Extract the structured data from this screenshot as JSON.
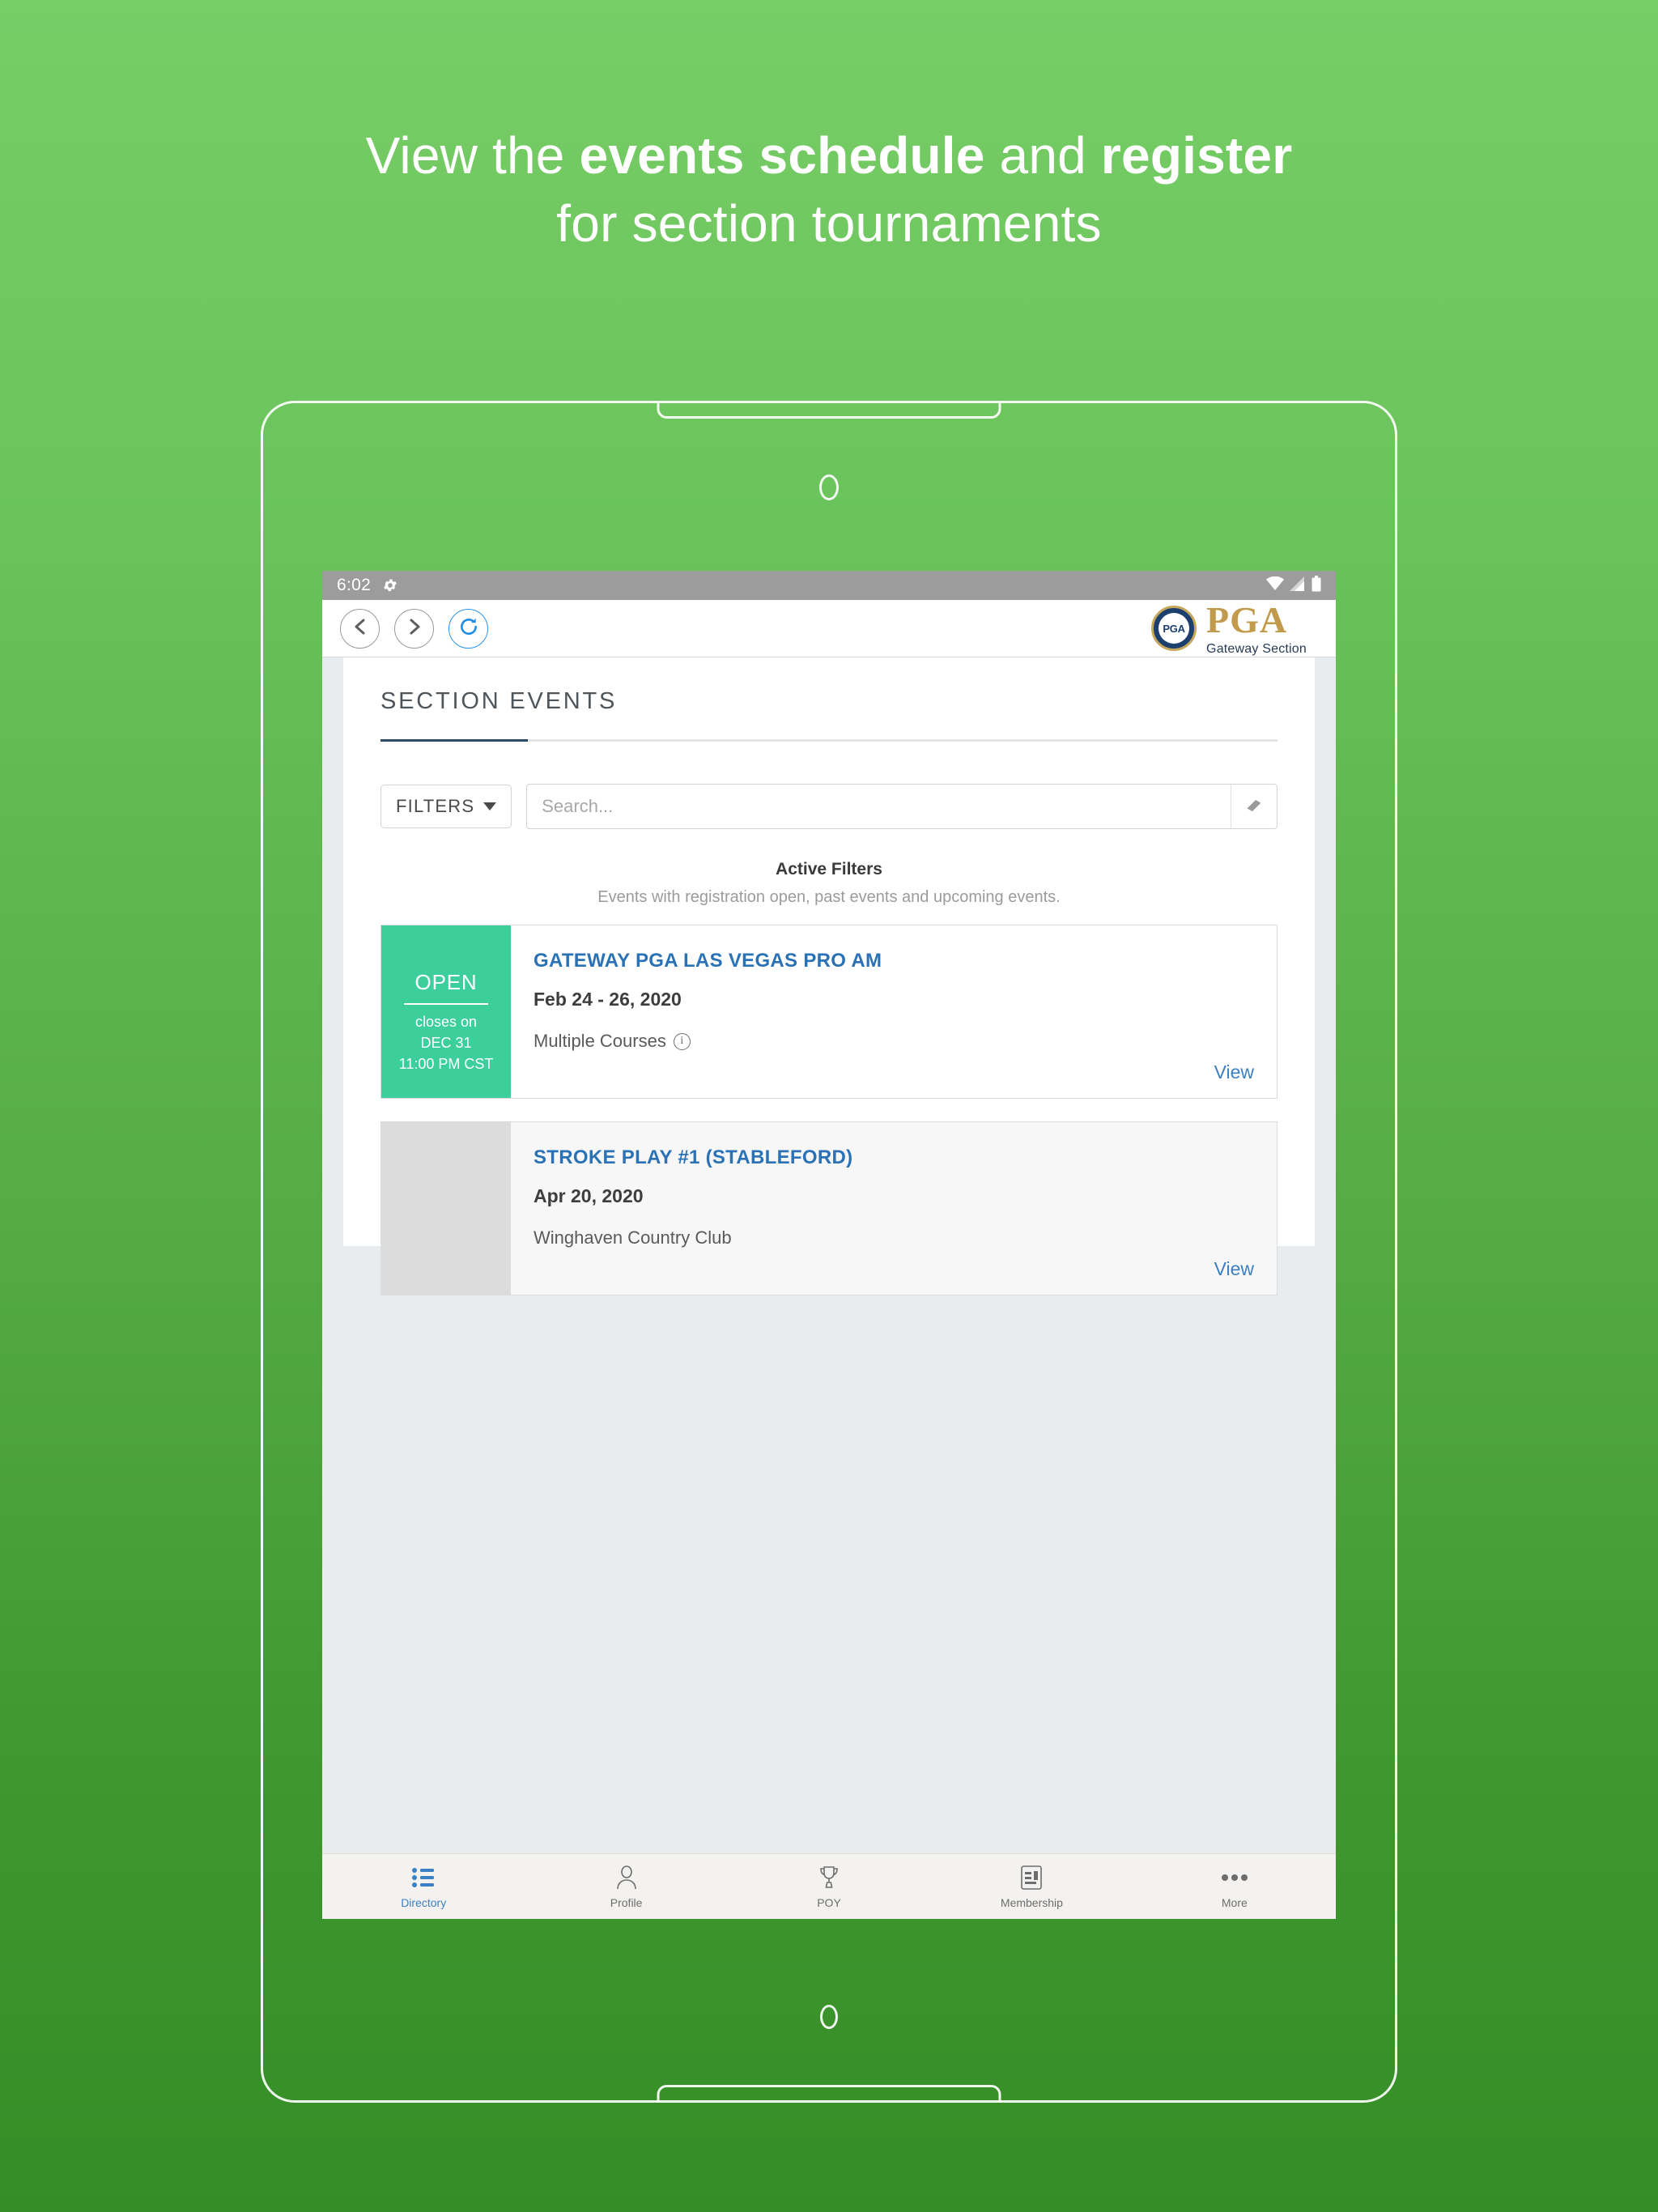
{
  "marketing": {
    "line1_prefix": "View the ",
    "line1_strong1": "events schedule",
    "line1_mid": " and ",
    "line1_strong2": "register",
    "line2": "for section tournaments"
  },
  "status_bar": {
    "time": "6:02",
    "gear_icon": "gear-icon",
    "wifi_icon": "wifi-icon",
    "signal_icon": "cell-signal-icon",
    "battery_icon": "battery-icon"
  },
  "browser": {
    "back_icon": "chevron-left-icon",
    "forward_icon": "chevron-right-icon",
    "refresh_icon": "refresh-icon",
    "brand": {
      "seal_text": "PGA",
      "wordmark": "PGA",
      "subtitle": "Gateway Section"
    }
  },
  "page": {
    "title": "SECTION EVENTS",
    "filters_button": "FILTERS",
    "search_placeholder": "Search...",
    "search_value": "",
    "eraser_icon": "eraser-icon",
    "active_filters_title": "Active Filters",
    "active_filters_desc": "Events with registration open, past events and upcoming events."
  },
  "events": [
    {
      "status": "OPEN",
      "closes_label": "closes on",
      "closes_date": "DEC  31",
      "closes_time": "11:00 PM CST",
      "title": "GATEWAY PGA LAS VEGAS PRO AM",
      "date": "Feb 24 - 26, 2020",
      "venue": "Multiple Courses",
      "has_info_icon": true,
      "view_label": "View",
      "badge_color": "#3ccf9c"
    },
    {
      "status": "",
      "closes_label": "",
      "closes_date": "",
      "closes_time": "",
      "title": "STROKE PLAY #1 (STABLEFORD)",
      "date": "Apr 20, 2020",
      "venue": "Winghaven Country Club",
      "has_info_icon": false,
      "view_label": "View",
      "badge_color": "#dcdcdc"
    }
  ],
  "bottom_nav": [
    {
      "label": "Directory",
      "icon": "list-icon",
      "active": true
    },
    {
      "label": "Profile",
      "icon": "person-icon",
      "active": false
    },
    {
      "label": "POY",
      "icon": "trophy-icon",
      "active": false
    },
    {
      "label": "Membership",
      "icon": "id-card-icon",
      "active": false
    },
    {
      "label": "More",
      "icon": "ellipsis-icon",
      "active": false
    }
  ],
  "colors": {
    "background_top": "#77cd66",
    "background_bottom": "#358d27",
    "accent_blue": "#2a72b5",
    "badge_green": "#3ccf9c",
    "brand_gold": "#c19a4b",
    "brand_navy": "#273b55"
  }
}
